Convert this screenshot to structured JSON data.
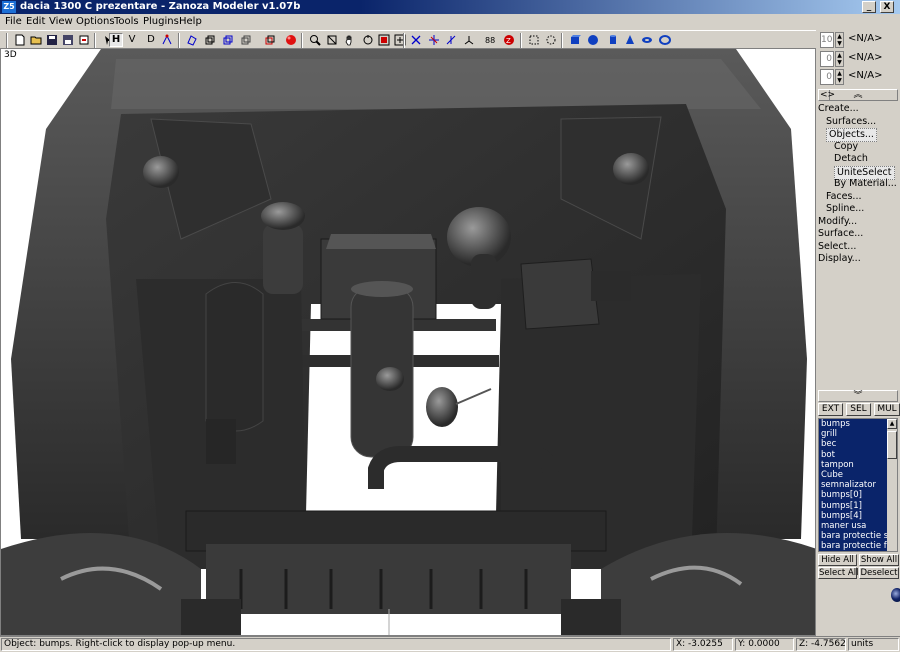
{
  "window": {
    "title": "dacia 1300 C prezentare - Zanoza Modeler v1.07b",
    "app_icon": "zanoza-app-icon",
    "minimize_glyph": "_",
    "close_glyph": "X"
  },
  "menu": [
    "File",
    "Edit",
    "View",
    "Options",
    "Tools",
    "Plugins",
    "Help"
  ],
  "toolbar": {
    "view_h": "H",
    "view_v": "V",
    "view_d": "D",
    "icons": [
      "new-file-icon",
      "open-folder-icon",
      "save-icon",
      "save-as-icon",
      "undo-icon",
      "pick-icon",
      "box-frame-icon",
      "cube-frame-icon",
      "cube-select-icon",
      "cube-red-icon",
      "sphere-red-icon",
      "zoom-icon",
      "pan-hand-icon",
      "rotate-icon",
      "zoom-region-icon",
      "fit-icon",
      "move-icon",
      "rotate-tool-icon",
      "scale-icon",
      "axis-icon",
      "grid-icon",
      "snap-icon",
      "select-box-icon",
      "select-lasso-icon",
      "box-primitive-icon",
      "sphere-primitive-icon",
      "cylinder-primitive-icon",
      "cone-primitive-icon",
      "torus-primitive-icon",
      "ring-primitive-icon"
    ],
    "accent": "#0000cc"
  },
  "viewport": {
    "label": "3D",
    "background": "#ffffff"
  },
  "panel": {
    "spinners": [
      {
        "num": "10",
        "value": "<N/A>"
      },
      {
        "num": "0",
        "value": "<N/A>"
      },
      {
        "num": "0",
        "value": "<N/A>"
      }
    ],
    "up_glyph": "︽",
    "down_glyph": "︾",
    "tree": [
      {
        "label": "Create...",
        "indent": 0,
        "selected": false
      },
      {
        "label": "Surfaces...",
        "indent": 1,
        "selected": false
      },
      {
        "label": "Objects...",
        "indent": 1,
        "selected": true
      },
      {
        "label": "Copy",
        "indent": 2,
        "selected": false
      },
      {
        "label": "Detach",
        "indent": 2,
        "selected": false
      },
      {
        "label": "UniteSelect",
        "indent": 2,
        "selected": true
      },
      {
        "label": "By Material...",
        "indent": 2,
        "selected": false
      },
      {
        "label": "Faces...",
        "indent": 1,
        "selected": false
      },
      {
        "label": "Spline...",
        "indent": 1,
        "selected": false
      },
      {
        "label": "Modify...",
        "indent": 0,
        "selected": false
      },
      {
        "label": "Surface...",
        "indent": 0,
        "selected": false
      },
      {
        "label": "Select...",
        "indent": 0,
        "selected": false
      },
      {
        "label": "Display...",
        "indent": 0,
        "selected": false
      }
    ],
    "mode_buttons": [
      "EXT",
      "SEL",
      "MUL"
    ],
    "objects": [
      "bumps",
      "grill",
      "bec",
      "bot",
      "tampon",
      "Cube",
      "semnalizator",
      "bumps[0]",
      "bumps[1]",
      "bumps[4]",
      "maner usa",
      "bara protectie spate",
      "bara protectie fata"
    ],
    "hide_all": "Hide All",
    "show_all": "Show All",
    "select_all": "Select All",
    "deselect": "Deselect",
    "list_bg": "#0a246a"
  },
  "status": {
    "message": "Object: bumps. Right-click to display pop-up menu.",
    "x": "X: -3.0255",
    "y": "Y: 0.0000",
    "z": "Z: -4.7562",
    "units": "units"
  }
}
